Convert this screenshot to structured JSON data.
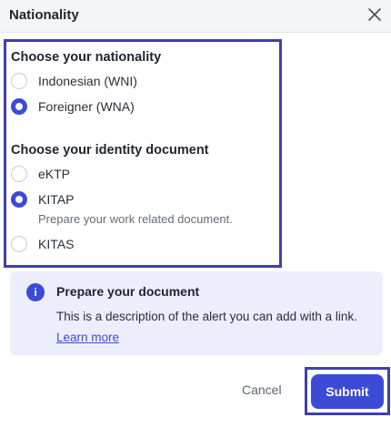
{
  "header": {
    "title": "Nationality"
  },
  "nationality": {
    "title": "Choose your nationality",
    "options": [
      {
        "label": "Indonesian (WNI)",
        "checked": false
      },
      {
        "label": "Foreigner (WNA)",
        "checked": true
      }
    ]
  },
  "identity": {
    "title": "Choose your identity document",
    "options": [
      {
        "label": "eKTP",
        "checked": false
      },
      {
        "label": "KITAP",
        "checked": true,
        "help": "Prepare your work related document."
      },
      {
        "label": "KITAS",
        "checked": false
      }
    ]
  },
  "alert": {
    "icon": "info-icon",
    "title": "Prepare your document",
    "description": "This is a description of the alert you can add with a link.",
    "link_label": "Learn more"
  },
  "footer": {
    "cancel_label": "Cancel",
    "submit_label": "Submit"
  },
  "colors": {
    "accent": "#3c4bd6",
    "highlight": "#3f3fb0",
    "alert_bg": "#eceefb"
  }
}
